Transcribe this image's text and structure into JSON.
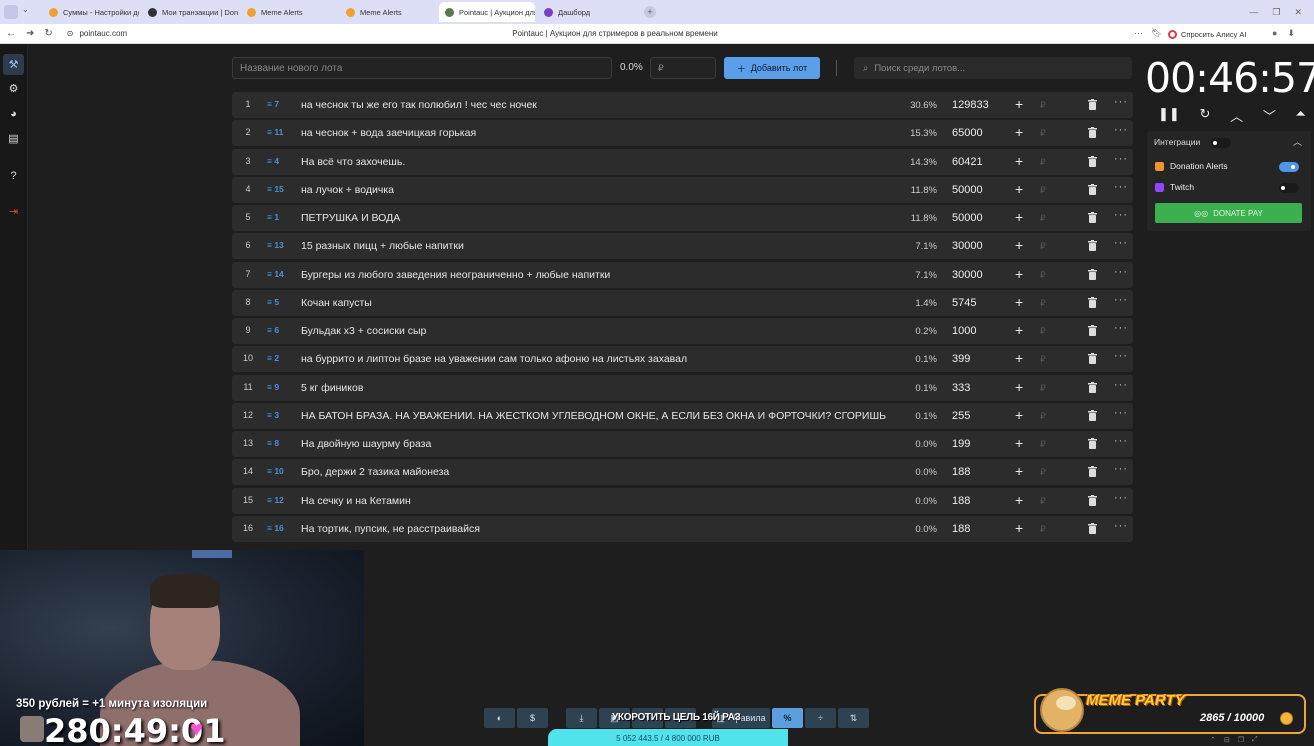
{
  "browser": {
    "tabs": [
      {
        "label": "Суммы - Настройки доне",
        "color": "#f0a030"
      },
      {
        "label": "Мои транзакции | Donat",
        "color": "#333333"
      },
      {
        "label": "Meme Alerts",
        "color": "#f0a030"
      },
      {
        "label": "Meme Alerts",
        "color": "#f0a030"
      },
      {
        "label": "Pointauc | Аукцион для",
        "color": "#5a7a4a",
        "active": true
      },
      {
        "label": "Дашборд",
        "color": "#7a3fc0"
      }
    ],
    "url": "pointauc.com",
    "page_title": "Pointauc | Аукцион для стримеров в реальном времени",
    "alice_label": "Спросить Алису AI"
  },
  "toolbar": {
    "new_lot_placeholder": "Название нового лота",
    "percent": "0.0%",
    "amount_placeholder": "₽",
    "add_lot_label": "Добавить лот",
    "search_placeholder": "Поиск среди лотов..."
  },
  "lots": [
    {
      "num": "1",
      "id": "7",
      "name": "на чеснок ты же его так полюбил ! чес чес ночек",
      "pct": "30.6%",
      "amount": "129833"
    },
    {
      "num": "2",
      "id": "11",
      "name": "на чеснок + вода заечицкая горькая",
      "pct": "15.3%",
      "amount": "65000"
    },
    {
      "num": "3",
      "id": "4",
      "name": "На всё что захочешь.",
      "pct": "14.3%",
      "amount": "60421"
    },
    {
      "num": "4",
      "id": "15",
      "name": "на лучок + водичка",
      "pct": "11.8%",
      "amount": "50000"
    },
    {
      "num": "5",
      "id": "1",
      "name": "ПЕТРУШКА И ВОДА",
      "pct": "11.8%",
      "amount": "50000"
    },
    {
      "num": "6",
      "id": "13",
      "name": "15 разных пицц + любые напитки",
      "pct": "7.1%",
      "amount": "30000"
    },
    {
      "num": "7",
      "id": "14",
      "name": "Бургеры из любого заведения неограниченно + любые напитки",
      "pct": "7.1%",
      "amount": "30000"
    },
    {
      "num": "8",
      "id": "5",
      "name": "Кочан капусты",
      "pct": "1.4%",
      "amount": "5745"
    },
    {
      "num": "9",
      "id": "6",
      "name": "Бульдак х3 + сосиски сыр",
      "pct": "0.2%",
      "amount": "1000"
    },
    {
      "num": "10",
      "id": "2",
      "name": "на буррито и липтон бразе на уважении сам только афоню на листьях захавал",
      "pct": "0.1%",
      "amount": "399"
    },
    {
      "num": "11",
      "id": "9",
      "name": "5 кг фиников",
      "pct": "0.1%",
      "amount": "333"
    },
    {
      "num": "12",
      "id": "3",
      "name": "НА БАТОН БРАЗА. НА УВАЖЕНИИ. НА ЖЕСТКОМ УГЛЕВОДНОМ ОКНЕ, А ЕСЛИ БЕЗ ОКНА И ФОРТОЧКИ? СГОРИШЬ",
      "pct": "0.1%",
      "amount": "255"
    },
    {
      "num": "13",
      "id": "8",
      "name": "На двойную шаурму браза",
      "pct": "0.0%",
      "amount": "199"
    },
    {
      "num": "14",
      "id": "10",
      "name": "Бро, держи 2 тазика майонеза",
      "pct": "0.0%",
      "amount": "188"
    },
    {
      "num": "15",
      "id": "12",
      "name": "На сечку и на Кетамин",
      "pct": "0.0%",
      "amount": "188"
    },
    {
      "num": "16",
      "id": "16",
      "name": "На тортик, пупсик, не расстраивайся",
      "pct": "0.0%",
      "amount": "188"
    }
  ],
  "timer": {
    "value": "00:46:57"
  },
  "integrations": {
    "header": "Интеграции",
    "donation_alerts": "Donation Alerts",
    "twitch": "Twitch",
    "donate_pay": "DONATE PAY"
  },
  "stream_overlay": {
    "caption": "350 рублей = +1 минута изоляции",
    "big_timer": "280:49:01",
    "shorten_goal": "УКОРОТИТЬ ЦЕЛЬ 16Й РАЗ",
    "progress_text": "5 052 443.5 / 4 800 000 RUB",
    "progress_fraction": 1.0,
    "meme_title": "MEME PARTY",
    "meme_count": "2865 / 10000"
  },
  "bottom_bar": {
    "rules_label": "Правила",
    "percent_label": "%"
  },
  "colors": {
    "accent": "#5b9fe8",
    "donate_pay": "#3cb04f",
    "progress": "#47d7e0"
  }
}
